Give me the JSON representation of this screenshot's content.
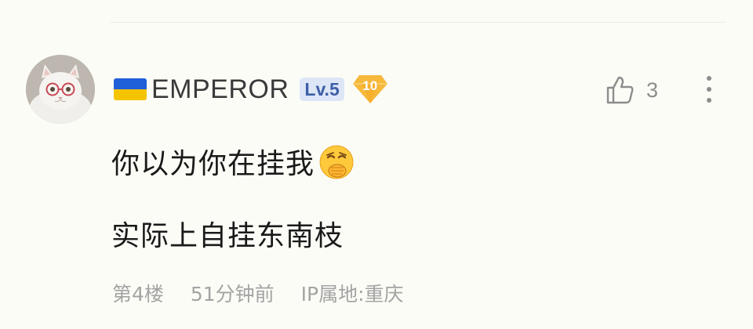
{
  "comment": {
    "user": {
      "flag_icon": "ukraine-flag-icon",
      "name": "EMPEROR",
      "level": "Lv.5",
      "fan_level": "10",
      "avatar": "white-cat-avatar"
    },
    "content": {
      "line1": "你以为你在挂我",
      "emoji": "hand-over-mouth-laugh-emoji",
      "line2": "实际上自挂东南枝"
    },
    "meta": {
      "floor": "第4楼",
      "time": "51分钟前",
      "ip_location": "IP属地:重庆"
    },
    "actions": {
      "like_icon": "thumbs-up-icon",
      "like_count": "3",
      "more_icon": "more-vertical-icon"
    }
  },
  "colors": {
    "background": "#fcfcf7",
    "level_badge_bg": "#dde6f6",
    "level_badge_text": "#3d5ea8",
    "fan_badge": "#f6b93b",
    "meta_text": "#a3a3a3"
  }
}
